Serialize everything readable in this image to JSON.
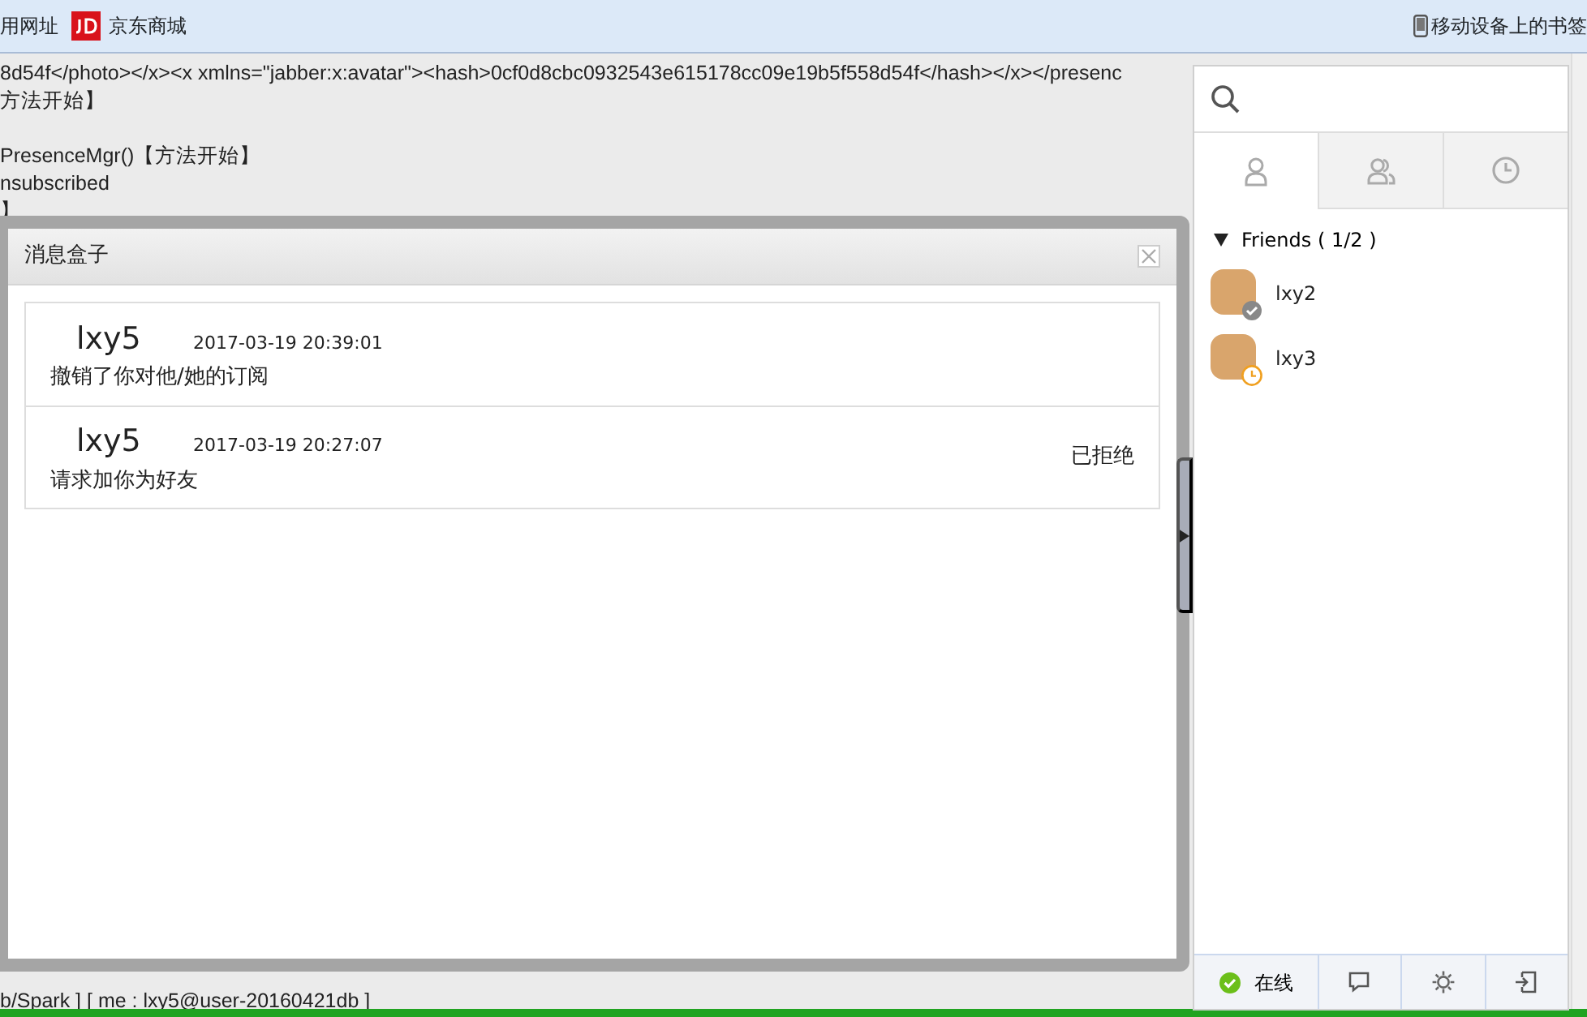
{
  "bookmarks_bar": {
    "items": [
      {
        "label": "用网址",
        "kind": "plain"
      },
      {
        "label": "京东商城",
        "kind": "jd"
      }
    ],
    "mobile_bookmarks": "移动设备上的书签"
  },
  "log_lines": [
    {
      "kind": "line",
      "text": "8d54f</photo></x><x xmlns=\"jabber:x:avatar\"><hash>0cf0d8cbc0932543e615178cc09e19b5f558d54f</hash></x></presenc"
    },
    {
      "kind": "line",
      "text": "方法开始】"
    },
    {
      "kind": "blank"
    },
    {
      "kind": "line",
      "text": "PresenceMgr()【方法开始】"
    },
    {
      "kind": "line",
      "text": "nsubscribed"
    },
    {
      "kind": "line",
      "text": "】"
    }
  ],
  "log_footer": "b/Spark ] [ me : lxy5@user-20160421db ]",
  "message_box": {
    "title": "消息盒子",
    "messages": [
      {
        "sender": "lxy5",
        "time": "2017-03-19 20:39:01",
        "text": "撤销了你对他/她的订阅"
      },
      {
        "sender": "lxy5",
        "time": "2017-03-19 20:27:07",
        "text": "请求加你为好友",
        "result": "已拒绝"
      }
    ]
  },
  "side_panel": {
    "tabs": [
      {
        "kind": "contacts",
        "selected": true
      },
      {
        "kind": "groups",
        "selected": false
      },
      {
        "kind": "recent",
        "selected": false
      }
    ],
    "group": {
      "label": "Friends ( 1/2 )",
      "expanded": true,
      "contacts": [
        {
          "name": "lxy2",
          "kind": "online"
        },
        {
          "name": "lxy3",
          "kind": "away"
        }
      ]
    },
    "footer": {
      "status": "在线"
    }
  }
}
